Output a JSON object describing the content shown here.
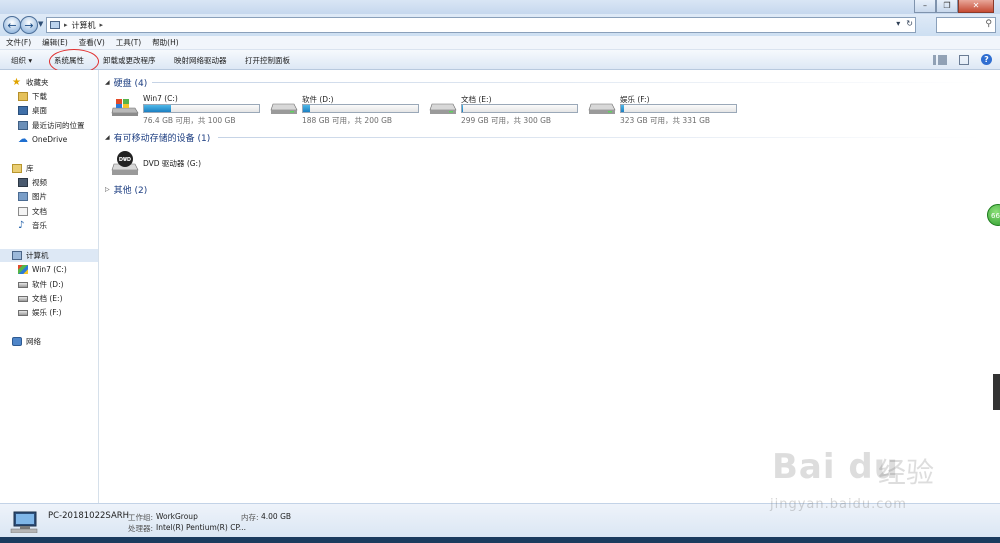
{
  "address_bar": {
    "crumb": "计算机"
  },
  "menu": [
    "文件(F)",
    "编辑(E)",
    "查看(V)",
    "工具(T)",
    "帮助(H)"
  ],
  "toolbar": {
    "organize": "组织 ▾",
    "system_properties": "系统属性",
    "uninstall": "卸载或更改程序",
    "map_drive": "映射网络驱动器",
    "control_panel": "打开控制面板"
  },
  "nav": {
    "favorites": "收藏夹",
    "downloads": "下载",
    "desktop": "桌面",
    "recent": "最近访问的位置",
    "onedrive": "OneDrive",
    "libraries": "库",
    "videos": "视频",
    "pictures": "图片",
    "documents": "文档",
    "music": "音乐",
    "computer": "计算机",
    "drive_c": "Win7 (C:)",
    "drive_d": "软件 (D:)",
    "drive_e": "文档 (E:)",
    "drive_f": "娱乐 (F:)",
    "network": "网络"
  },
  "sections": {
    "hdd": "硬盘 (4)",
    "removable": "有可移动存储的设备 (1)",
    "other": "其他 (2)"
  },
  "drives": [
    {
      "name": "Win7 (C:)",
      "size": "76.4 GB 可用，共 100 GB",
      "used_fraction": 0.236
    },
    {
      "name": "软件 (D:)",
      "size": "188 GB 可用，共 200 GB",
      "used_fraction": 0.06
    },
    {
      "name": "文档 (E:)",
      "size": "299 GB 可用，共 300 GB",
      "used_fraction": 0.003
    },
    {
      "name": "娱乐 (F:)",
      "size": "323 GB 可用，共 331 GB",
      "used_fraction": 0.024
    }
  ],
  "dvd": {
    "name": "DVD 驱动器 (G:)",
    "icon_label": "DVD"
  },
  "status": {
    "pc_name": "PC-20181022SARH",
    "workgroup_label": "工作组:",
    "workgroup": "WorkGroup",
    "memory_label": "内存:",
    "memory": "4.00 GB",
    "cpu_label": "处理器:",
    "cpu": "Intel(R) Pentium(R) CP..."
  },
  "watermark": {
    "brand": "Bai du",
    "cn": "经验",
    "url": "jingyan.baidu.com"
  },
  "badge": "66",
  "colors": {
    "section_header": "#1e3f82",
    "drive_fill": "#1b7fc2",
    "highlight": "#e03030"
  }
}
